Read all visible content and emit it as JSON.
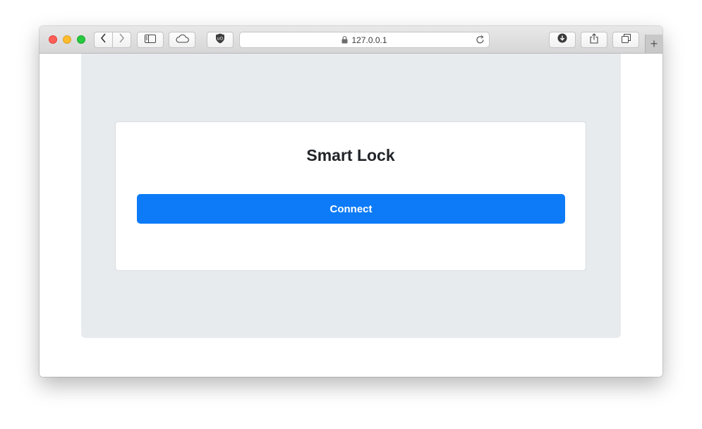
{
  "browser": {
    "address_text": "127.0.0.1",
    "new_tab_label": "+",
    "icons": [
      "back-icon",
      "forward-icon",
      "sidebar-icon",
      "cloud-icon",
      "shield-icon",
      "lock-icon",
      "reload-icon",
      "download-icon",
      "share-icon",
      "tabs-icon"
    ]
  },
  "page": {
    "title": "Smart Lock",
    "connect_label": "Connect",
    "colors": {
      "panel_bg": "#e8ebee",
      "button_bg": "#0d7bf8",
      "title_text": "#212529"
    }
  }
}
